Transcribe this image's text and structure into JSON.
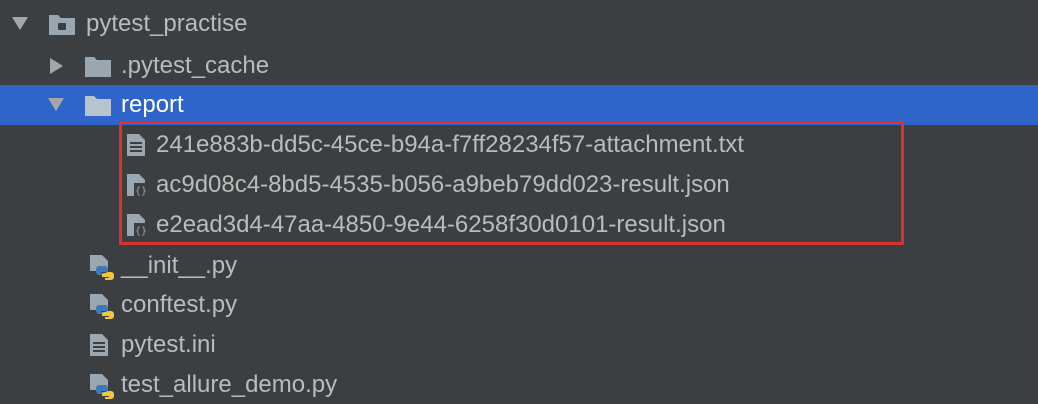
{
  "project": {
    "name": "pytest_practise",
    "icon": "project-folder-icon"
  },
  "items": [
    {
      "name": ".pytest_cache",
      "type": "folder",
      "expanded": false,
      "icon": "folder-icon"
    },
    {
      "name": "report",
      "type": "folder",
      "expanded": true,
      "selected": true,
      "icon": "folder-icon"
    },
    {
      "name": "241e883b-dd5c-45ce-b94a-f7ff28234f57-attachment.txt",
      "type": "text-file",
      "icon": "text-file-icon"
    },
    {
      "name": "ac9d08c4-8bd5-4535-b056-a9beb79dd023-result.json",
      "type": "json-file",
      "icon": "json-file-icon"
    },
    {
      "name": "e2ead3d4-47aa-4850-9e44-6258f30d0101-result.json",
      "type": "json-file",
      "icon": "json-file-icon"
    },
    {
      "name": "__init__.py",
      "type": "python-file",
      "icon": "python-file-icon"
    },
    {
      "name": "conftest.py",
      "type": "python-file",
      "icon": "python-file-icon"
    },
    {
      "name": "pytest.ini",
      "type": "text-file",
      "icon": "text-file-icon"
    },
    {
      "name": "test_allure_demo.py",
      "type": "python-file",
      "icon": "python-file-icon"
    }
  ],
  "colors": {
    "background": "#3c3f41",
    "selection": "#2f65ca",
    "highlight_border": "#e0302a",
    "text": "#bbbbbb"
  }
}
